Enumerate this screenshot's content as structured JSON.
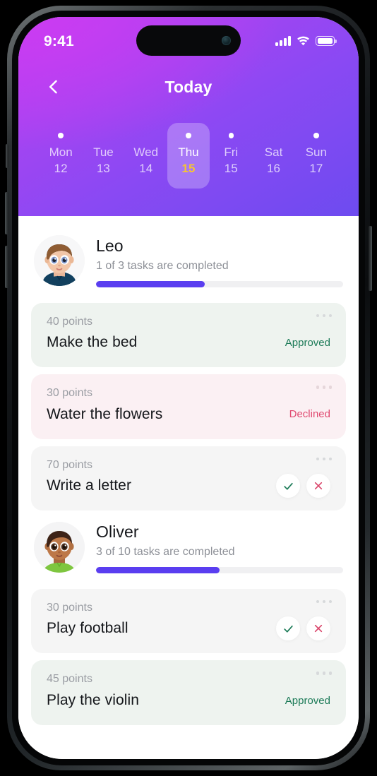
{
  "status_bar": {
    "time": "9:41",
    "cellular_icon": "cellular-signal-icon",
    "wifi_icon": "wifi-icon",
    "battery_icon": "battery-full-icon"
  },
  "nav": {
    "back_icon": "chevron-left-icon",
    "title": "Today"
  },
  "week": {
    "days": [
      {
        "name": "Mon",
        "num": "12",
        "dot": true,
        "selected": false
      },
      {
        "name": "Tue",
        "num": "13",
        "dot": false,
        "selected": false
      },
      {
        "name": "Wed",
        "num": "14",
        "dot": false,
        "selected": false
      },
      {
        "name": "Thu",
        "num": "15",
        "dot": true,
        "selected": true
      },
      {
        "name": "Fri",
        "num": "15",
        "dot": true,
        "selected": false
      },
      {
        "name": "Sat",
        "num": "16",
        "dot": false,
        "selected": false
      },
      {
        "name": "Sun",
        "num": "17",
        "dot": true,
        "selected": false
      }
    ]
  },
  "children": [
    {
      "name": "Leo",
      "subtitle": "1 of 3 tasks are completed",
      "progress_percent": 44,
      "avatar": "boy-brown-hair-navy-shirt-avatar",
      "tasks": [
        {
          "points": "40 points",
          "title": "Make the bed",
          "state": "approved",
          "status_label": "Approved"
        },
        {
          "points": "30 points",
          "title": "Water the flowers",
          "state": "declined",
          "status_label": "Declined"
        },
        {
          "points": "70 points",
          "title": "Write a letter",
          "state": "pending",
          "status_label": ""
        }
      ]
    },
    {
      "name": "Oliver",
      "subtitle": "3 of 10 tasks are completed",
      "progress_percent": 50,
      "avatar": "boy-dark-hair-green-hoodie-avatar",
      "tasks": [
        {
          "points": "30 points",
          "title": "Play football",
          "state": "pending",
          "status_label": ""
        },
        {
          "points": "45 points",
          "title": "Play the violin",
          "state": "approved",
          "status_label": "Approved"
        }
      ]
    }
  ],
  "icons": {
    "menu": "more-options-icon",
    "approve": "check-icon",
    "decline": "close-x-icon"
  },
  "colors": {
    "header_gradient_start": "#bd3df0",
    "header_gradient_end": "#6d4bf0",
    "progress": "#5a3ef0",
    "selected_day_number": "#f5c434",
    "approved": "#1b7a57",
    "declined": "#e0486f"
  }
}
